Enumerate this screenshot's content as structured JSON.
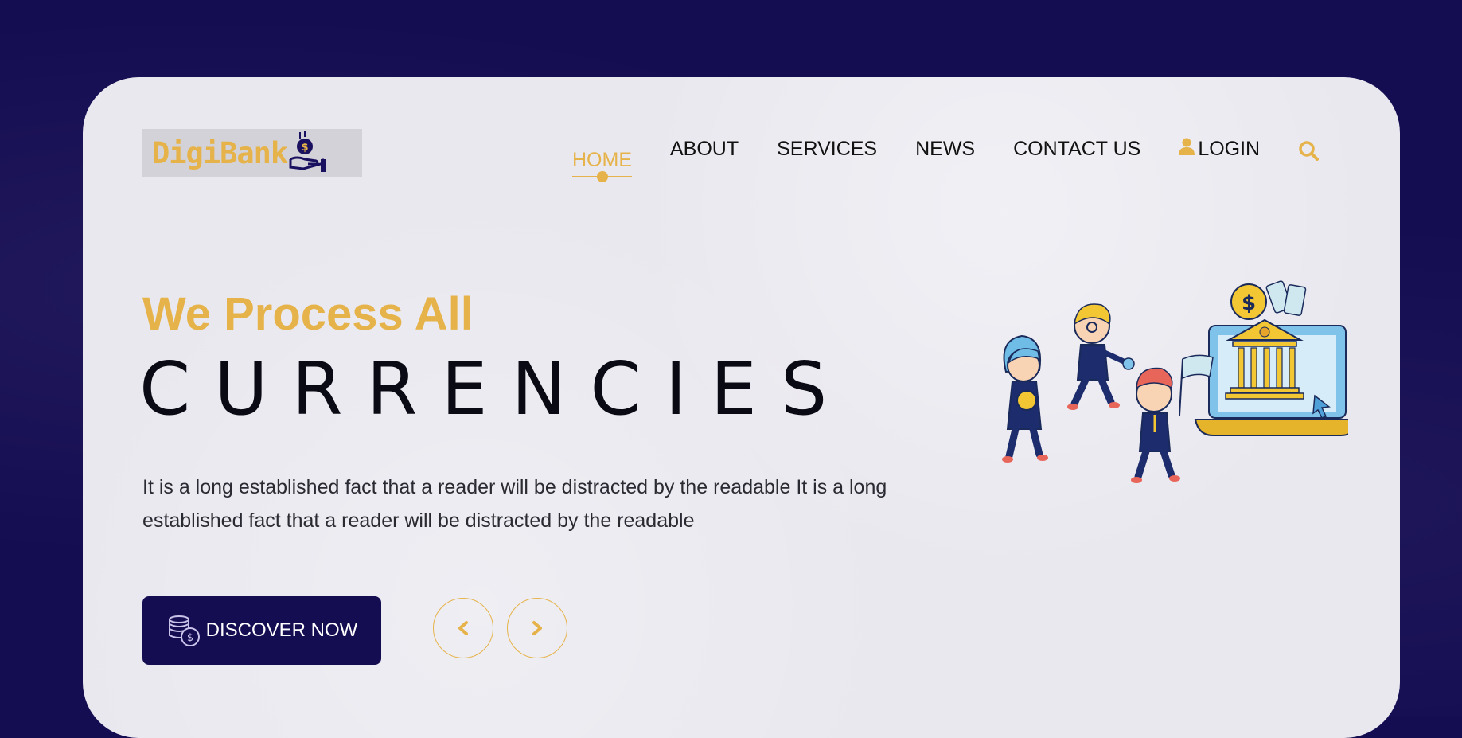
{
  "brand": {
    "logo_text": "DigiBank"
  },
  "nav": {
    "items": [
      "HOME",
      "ABOUT",
      "SERVICES",
      "NEWS",
      "CONTACT US"
    ],
    "active": "HOME",
    "login_label": "LOGIN"
  },
  "hero": {
    "subtitle": "We Process All",
    "title": "CURRENCIES",
    "description": "It is a long established fact that a reader will be distracted by the readable It is a long established fact that a reader will be distracted by the readable",
    "cta_label": "DISCOVER NOW"
  },
  "icons": {
    "logo": "hand-coin-icon",
    "login": "user-icon",
    "search": "search-icon",
    "cta": "coins-icon",
    "prev": "chevron-left-icon",
    "next": "chevron-right-icon"
  },
  "colors": {
    "background": "#150d52",
    "card": "#e9e8ef",
    "accent": "#e6b34a",
    "button": "#150d52"
  }
}
